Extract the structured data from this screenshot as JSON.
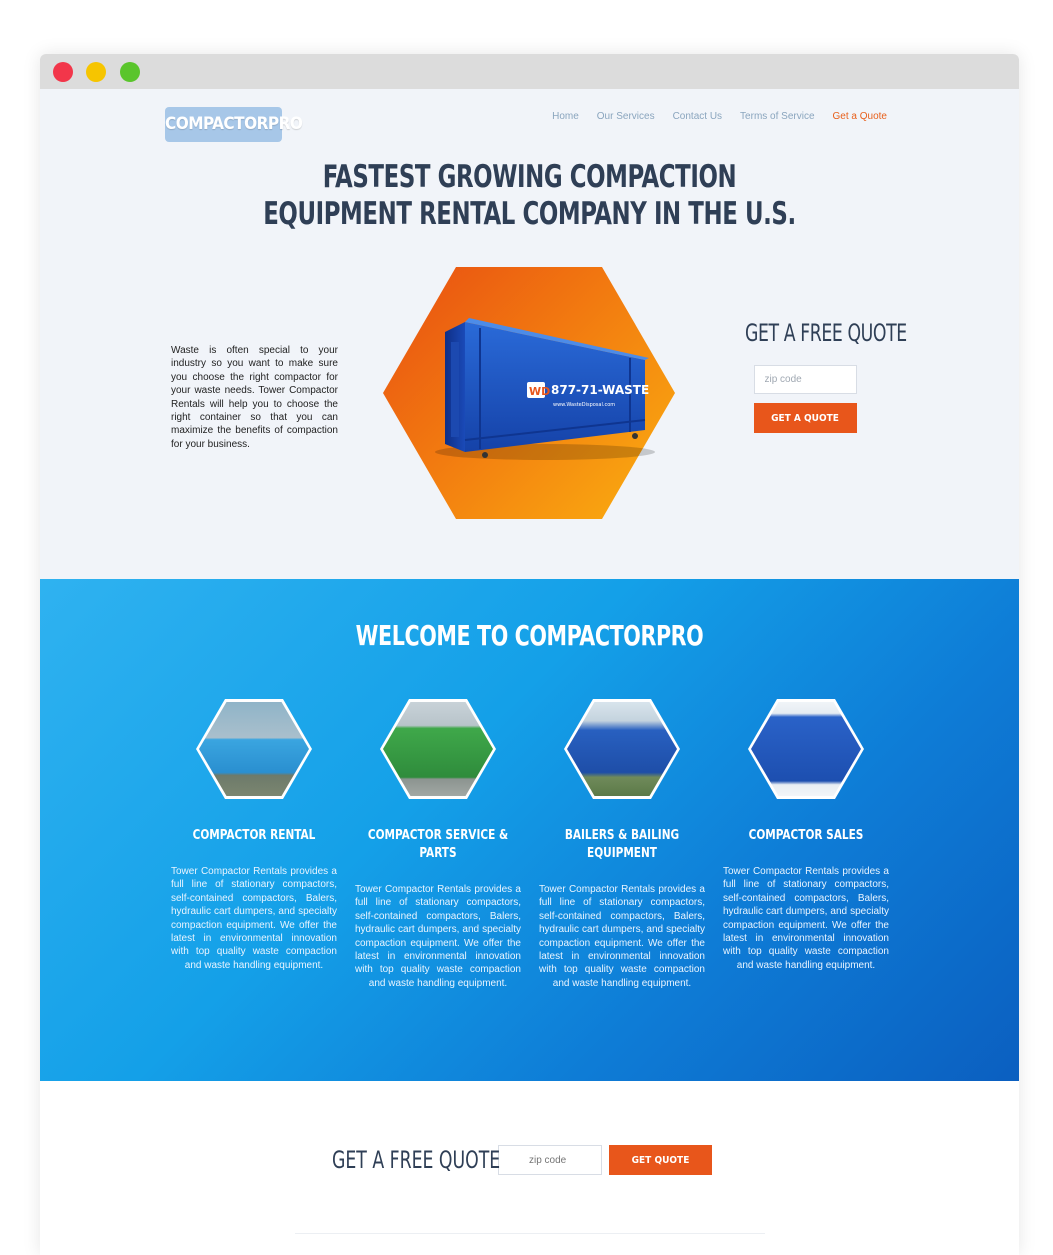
{
  "window": {
    "colors": {
      "close": "#f2364a",
      "minimize": "#f6c500",
      "maximize": "#5ac52c"
    }
  },
  "header": {
    "logo_text": "COMPACTORPRO",
    "nav": [
      {
        "label": "Home"
      },
      {
        "label": "Our Services"
      },
      {
        "label": "Contact Us"
      },
      {
        "label": "Terms of Service"
      },
      {
        "label": "Get a Quote"
      }
    ]
  },
  "hero": {
    "headline_line1": "FASTEST GROWING COMPACTION",
    "headline_line2": "EQUIPMENT RENTAL COMPANY IN THE U.S.",
    "intro_text": "Waste is often special to your industry so you want to make sure you choose the right compactor for your waste needs. Tower Compactor Rentals will help you to choose the right container so that you can maximize the benefits of compaction for your business.",
    "container_phone": "877-71-WASTE",
    "container_url": "www.WasteDisposal.com",
    "container_brand": "WD",
    "quote_title": "GET A FREE QUOTE",
    "zip_placeholder": "zip code",
    "quote_button": "GET A QUOTE"
  },
  "welcome": {
    "title": "WELCOME TO COMPACTORPRO",
    "services": [
      {
        "title_line1": "COMPACTOR RENTAL",
        "title_line2": "",
        "description": "Tower Compactor Rentals provides a full line of stationary compactors, self-contained compactors, Balers, hydraulic cart dumpers, and specialty compaction equipment. We offer the latest in environmental innovation with top quality waste compaction and waste handling equipment."
      },
      {
        "title_line1": "COMPACTOR SERVICE &",
        "title_line2": "PARTS",
        "description": "Tower Compactor Rentals provides a full line of stationary compactors, self-contained compactors, Balers, hydraulic cart dumpers, and specialty compaction equipment. We offer the latest in environmental innovation with top quality waste compaction and waste handling equipment."
      },
      {
        "title_line1": "BAILERS & BAILING",
        "title_line2": "EQUIPMENT",
        "description": "Tower Compactor Rentals provides a full line of stationary compactors, self-contained compactors, Balers, hydraulic cart dumpers, and specialty compaction equipment. We offer the latest in environmental innovation with top quality waste compaction and waste handling equipment."
      },
      {
        "title_line1": "COMPACTOR SALES",
        "title_line2": "",
        "description": "Tower Compactor Rentals provides a full line of stationary compactors, self-contained compactors, Balers, hydraulic cart dumpers, and specialty compaction equipment. We offer the latest in environmental innovation with top quality waste compaction and waste handling equipment."
      }
    ]
  },
  "bottom": {
    "title": "GET A FREE QUOTE",
    "zip_placeholder": "zip code",
    "button": "GET QUOTE"
  },
  "colors": {
    "accent": "#e8561b",
    "heading": "#2f3f56",
    "blue_start": "#2fb2f0",
    "blue_end": "#0b5fc0"
  }
}
